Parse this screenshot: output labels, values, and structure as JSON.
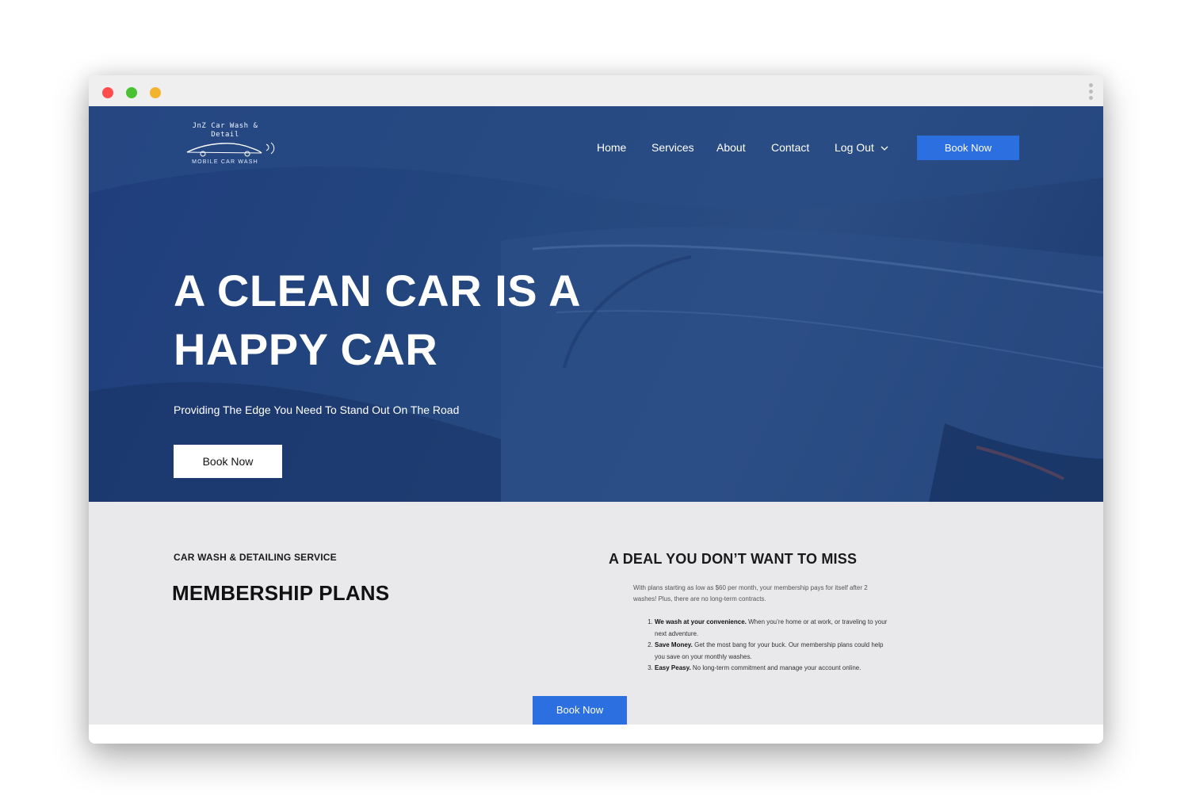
{
  "colors": {
    "hero_bg": "#24477f",
    "accent": "#2c6fe0",
    "content_bg": "#e9e9ec"
  },
  "logo": {
    "line1": "JnZ Car Wash &",
    "line2": "Detail",
    "tagline": "MOBILE CAR WASH"
  },
  "nav": {
    "items": [
      {
        "label": "Home"
      },
      {
        "label": "Services"
      },
      {
        "label": "About"
      },
      {
        "label": "Contact"
      },
      {
        "label": "Log Out"
      }
    ],
    "book_label": "Book Now"
  },
  "hero": {
    "title": "A CLEAN CAR IS A HAPPY CAR",
    "subtitle": "Providing The Edge You Need To Stand Out On The Road",
    "button_label": "Book Now"
  },
  "membership": {
    "eyebrow": "CAR WASH & DETAILING SERVICE",
    "title": "MEMBERSHIP PLANS"
  },
  "deal": {
    "title": "A DEAL YOU DON’T WANT TO MISS",
    "intro": "With plans starting as low as $60 per month, your membership pays for itself after 2 washes! Plus, there are no long-term contracts.",
    "items": [
      {
        "bold": "We wash at your convenience.",
        "text": " When you’re home or at work, or traveling to your next adventure."
      },
      {
        "bold": "Save Money.",
        "text": " Get the most bang for your buck. Our membership plans could help you save on your monthly washes."
      },
      {
        "bold": "Easy Peasy.",
        "text": " No long-term commitment and manage your account online."
      }
    ],
    "button_label": "Book Now"
  }
}
